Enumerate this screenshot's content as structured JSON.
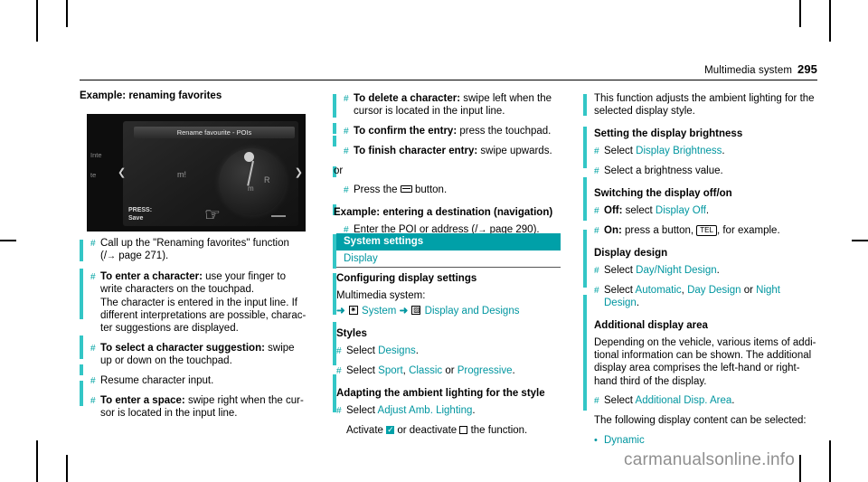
{
  "header": {
    "system": "Multimedia system",
    "page": "295"
  },
  "watermark": "carmanualsonline.info",
  "col1": {
    "title": "Example: renaming favorites",
    "screenshot": {
      "title_bar": "Rename favourite - POIs",
      "left_labels": [
        "Inte",
        "te"
      ],
      "press_label_1": "PRESS:",
      "press_label_2": "Save",
      "wheel_glyph_1": "m!",
      "wheel_glyph_2": "R",
      "wheel_glyph_3": "m"
    },
    "steps": [
      {
        "marker": "#",
        "text_html": "Call up the \"Renaming favorites\" function (/→ page 271)."
      },
      {
        "marker": "#",
        "text_html": "<b>To enter a character:</b> use your finger to write characters on the touchpad.<br>The character is entered in the input line. If different interpretations are possible, charac-ter suggestions are displayed."
      },
      {
        "marker": "#",
        "text_html": "<b>To select a character suggestion:</b> swipe up or down on the touchpad."
      },
      {
        "marker": "#",
        "text_html": "Resume character input."
      },
      {
        "marker": "#",
        "text_html": "<b>To enter a space:</b> swipe right when the cur-sor is located in the input line."
      }
    ]
  },
  "col2": {
    "steps_top": [
      {
        "marker": "#",
        "text_html": "<b>To delete a character:</b> swipe left when the cursor is located in the input line."
      },
      {
        "marker": "#",
        "text_html": "<b>To confirm the entry:</b> press the touchpad."
      },
      {
        "marker": "#",
        "text_html": "<b>To finish character entry:</b> swipe upwards."
      }
    ],
    "or_label": "or",
    "press_button_step": {
      "marker": "#",
      "text_before": "Press the",
      "text_after": "button."
    },
    "example_heading": "Example: entering a destination (navigation)",
    "example_step": {
      "marker": "#",
      "text_html": "Enter the POI or address (/→ page 290)."
    },
    "banner": "System settings",
    "subbanner": "Display",
    "configuring_heading": "Configuring display settings",
    "configuring_text": "Multimedia system:",
    "path_row": {
      "arrow1": "➜",
      "label1": "System",
      "arrow2": "➜",
      "label2": "Display and Designs"
    },
    "styles_heading": "Styles",
    "styles_steps": [
      {
        "marker": "#",
        "text_before": "Select",
        "link": "Designs",
        "text_after": "."
      },
      {
        "marker": "#",
        "text_before": "Select",
        "links": [
          "Sport",
          "Classic",
          "Progressive"
        ],
        "text_after": "."
      }
    ],
    "ambient_heading": "Adapting the ambient lighting for the style",
    "ambient_steps": [
      {
        "marker": "#",
        "text_before": "Select",
        "link": "Adjust Amb. Lighting",
        "text_after": "."
      },
      {
        "marker": "",
        "text_before": "Activate",
        "mid": "or deactivate",
        "text_after": "the function."
      }
    ]
  },
  "col3": {
    "intro": "This function adjusts the ambient lighting for the selected display style.",
    "brightness_heading": "Setting the display brightness",
    "brightness_steps": [
      {
        "marker": "#",
        "text_before": "Select",
        "link": "Display Brightness",
        "text_after": "."
      },
      {
        "marker": "#",
        "text_before": "Select a brightness value.",
        "link": "",
        "text_after": ""
      }
    ],
    "switching_heading": "Switching the display off/on",
    "switching_steps": [
      {
        "marker": "#",
        "label": "Off:",
        "text_before": "select",
        "link": "Display Off",
        "text_after": "."
      },
      {
        "marker": "#",
        "label": "On:",
        "text_before": "press a button,",
        "key": "TEL",
        "text_after": ", for example."
      }
    ],
    "design_heading": "Display design",
    "design_steps": [
      {
        "marker": "#",
        "text_before": "Select",
        "link": "Day/Night Design",
        "text_after": "."
      },
      {
        "marker": "#",
        "text_before": "Select",
        "links": [
          "Automatic",
          "Day Design",
          "Night Design"
        ],
        "text_after": "."
      }
    ],
    "additional_heading": "Additional display area",
    "additional_text": "Depending on the vehicle, various items of addi-tional information can be shown. The additional display area comprises the left-hand or right-hand third of the display.",
    "additional_step": {
      "marker": "#",
      "text_before": "Select",
      "link": "Additional Disp. Area",
      "text_after": "."
    },
    "following_text": "The following display content can be selected:",
    "bullet": {
      "marker": "•",
      "link": "Dynamic"
    }
  },
  "colors": {
    "accent": "#00a0a8",
    "link": "#0096a0",
    "changebar": "#33c6c6"
  }
}
